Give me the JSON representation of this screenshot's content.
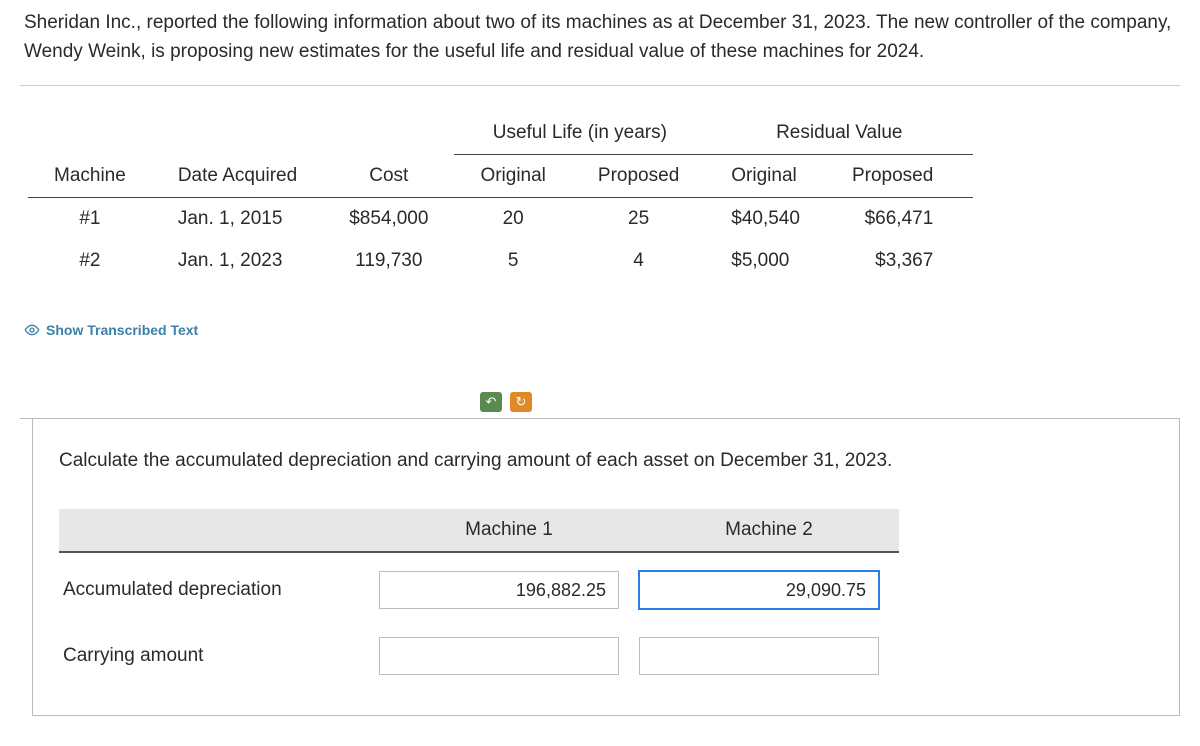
{
  "intro": "Sheridan Inc., reported the following information about two of its machines as at December 31, 2023. The new controller of the company, Wendy Weink, is proposing new estimates for the useful life and residual value of these machines for 2024.",
  "machinesTable": {
    "groupHeaders": {
      "useful_life": "Useful Life (in years)",
      "residual_value": "Residual Value"
    },
    "headers": {
      "machine": "Machine",
      "date_acquired": "Date Acquired",
      "cost": "Cost",
      "ul_original": "Original",
      "ul_proposed": "Proposed",
      "rv_original": "Original",
      "rv_proposed": "Proposed"
    },
    "rows": [
      {
        "machine": "#1",
        "date_acquired": "Jan. 1, 2015",
        "cost": "$854,000",
        "ul_original": "20",
        "ul_proposed": "25",
        "rv_original": "$40,540",
        "rv_proposed": "$66,471"
      },
      {
        "machine": "#2",
        "date_acquired": "Jan. 1, 2023",
        "cost": "119,730",
        "ul_original": "5",
        "ul_proposed": "4",
        "rv_original": "$5,000",
        "rv_proposed": "$3,367"
      }
    ]
  },
  "show_transcribed": "Show Transcribed Text",
  "answer": {
    "prompt": "Calculate the accumulated depreciation and carrying amount of each asset on December 31, 2023.",
    "col1": "Machine 1",
    "col2": "Machine 2",
    "row1_label": "Accumulated depreciation",
    "row2_label": "Carrying amount",
    "values": {
      "accdep_m1": "196,882.25",
      "accdep_m2": "29,090.75",
      "carry_m1": "",
      "carry_m2": ""
    }
  }
}
